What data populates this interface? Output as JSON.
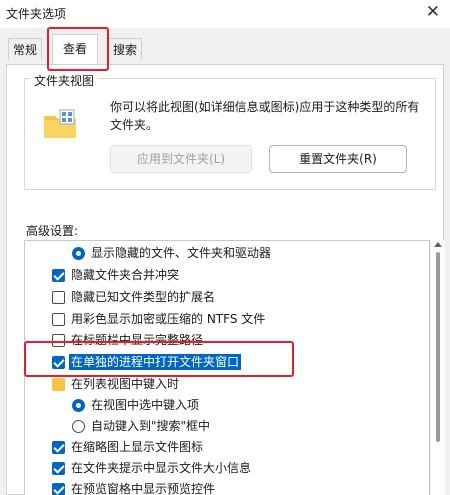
{
  "window": {
    "title": "文件夹选项",
    "close": "✕"
  },
  "tabs": [
    {
      "label": "常规"
    },
    {
      "label": "查看"
    },
    {
      "label": "搜索"
    }
  ],
  "folder_views": {
    "group_label": "文件夹视图",
    "description": "你可以将此视图(如详细信息或图标)应用于这种类型的所有文件夹。",
    "apply_button": "应用到文件夹(L)",
    "reset_button": "重置文件夹(R)"
  },
  "advanced": {
    "label": "高级设置:",
    "items": [
      {
        "text": "显示隐藏的文件、文件夹和驱动器",
        "control": "radio",
        "state": "selected"
      },
      {
        "text": "隐藏文件夹合并冲突",
        "control": "checkbox",
        "state": "checked"
      },
      {
        "text": "隐藏已知文件类型的扩展名",
        "control": "checkbox",
        "state": "unchecked"
      },
      {
        "text": "用彩色显示加密或压缩的 NTFS 文件",
        "control": "checkbox",
        "state": "unchecked"
      },
      {
        "text": "在标题栏中显示完整路径",
        "control": "checkbox",
        "state": "unchecked"
      },
      {
        "text": "在单独的进程中打开文件夹窗口",
        "control": "checkbox",
        "state": "checked"
      },
      {
        "text": "在列表视图中键入时",
        "control": "folder",
        "state": ""
      },
      {
        "text": "在视图中选中键入项",
        "control": "radio",
        "state": "selected"
      },
      {
        "text": "自动键入到\"搜索\"框中",
        "control": "radio",
        "state": "unselected"
      },
      {
        "text": "在缩略图上显示文件图标",
        "control": "checkbox",
        "state": "checked"
      },
      {
        "text": "在文件夹提示中显示文件大小信息",
        "control": "checkbox",
        "state": "checked"
      },
      {
        "text": "在预览窗格中显示预览控件",
        "control": "checkbox",
        "state": "checked"
      }
    ]
  },
  "colors": {
    "accent": "#0067c0",
    "annotation": "#e0202a"
  }
}
